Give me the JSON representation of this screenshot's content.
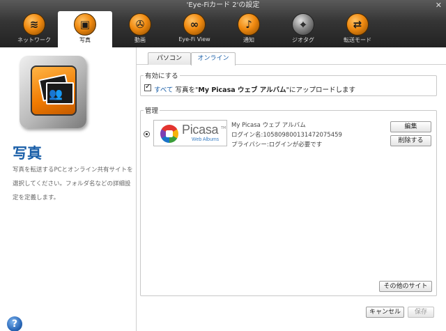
{
  "window": {
    "title": "'Eye-Fiカード 2'の設定",
    "close": "✕"
  },
  "toolbar": {
    "items": [
      {
        "label": "ネットワーク",
        "icon": "wifi-icon",
        "glyph": "≋"
      },
      {
        "label": "写真",
        "icon": "photos-icon",
        "glyph": "▣",
        "active": true
      },
      {
        "label": "動画",
        "icon": "video-reel-icon",
        "glyph": "✇"
      },
      {
        "label": "Eye-Fi View",
        "icon": "binoculars-icon",
        "glyph": "∞"
      },
      {
        "label": "通知",
        "icon": "bell-icon",
        "glyph": "♪"
      },
      {
        "label": "ジオタグ",
        "icon": "geotag-icon",
        "glyph": "⌖"
      },
      {
        "label": "転送モード",
        "icon": "transfer-mode-icon",
        "glyph": "⇄"
      }
    ]
  },
  "left": {
    "title": "写真",
    "description": "写真を転送するPCとオンライン共有サイトを選択してください。フォルダ名などの詳細設定を定義します。",
    "help": "?"
  },
  "tabs": [
    {
      "label": "パソコン",
      "active": false
    },
    {
      "label": "オンライン",
      "active": true
    }
  ],
  "enable_section": {
    "legend": "有効にする",
    "checked": true,
    "link": "すべて",
    "text_before": " 写真を\"",
    "service_bold": "My Picasa ウェブ アルバム",
    "text_after": "\"にアップロードします"
  },
  "manage_section": {
    "legend": "管理",
    "logo": {
      "name": "Picasa",
      "tm": "TM",
      "sub": "Web Albums"
    },
    "service_title": "My Picasa ウェブ アルバム",
    "login": "ログイン名:105809800131472075459",
    "privacy": "プライバシー:ログインが必要です",
    "edit_button": "編集",
    "delete_button": "削除する",
    "other_sites_button": "その他のサイト"
  },
  "footer": {
    "cancel": "キャンセル",
    "save": "保存"
  },
  "colors": {
    "accent": "#1a5fa8",
    "toolbar": "#2b2b2b",
    "icon_orange": "#f08a10"
  }
}
